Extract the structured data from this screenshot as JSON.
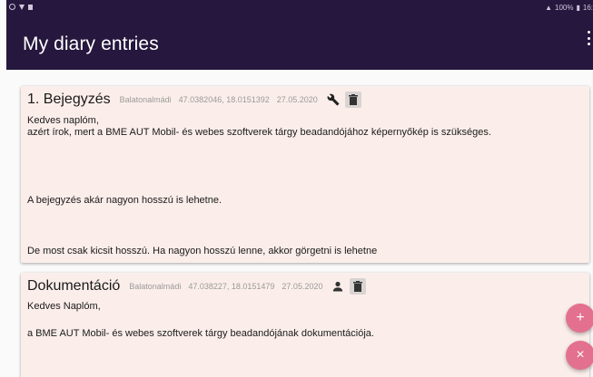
{
  "status_bar": {
    "right_text": "100%",
    "time": "16:"
  },
  "app_bar": {
    "title": "My diary entries"
  },
  "entries": [
    {
      "title": "1. Bejegyzés",
      "location": "Balatonalmádi",
      "coordinates": "47.0382046, 18.0151392",
      "date": "27.05.2020",
      "action_icon": "wrench-icon",
      "lines": [
        "Kedves naplóm,",
        "azért írok, mert a BME AUT Mobil- és webes szoftverek tárgy beadandójához képernyőkép is szükséges.",
        "A bejegyzés akár nagyon hosszú is lehetne.",
        "De most csak kicsit hosszú. Ha nagyon hosszú lenne, akkor görgetni is lehetne"
      ]
    },
    {
      "title": "Dokumentáció",
      "location": "Balatonalmádi",
      "coordinates": "47.038227, 18.0151479",
      "date": "27.05.2020",
      "action_icon": "person-icon",
      "lines": [
        "Kedves Naplóm,",
        "a BME AUT Mobil- és webes szoftverek tárgy beadandójának dokumentációja."
      ]
    }
  ],
  "fabs": {
    "add_label": "+",
    "close_label": "×"
  },
  "colors": {
    "app_bar": "#25173d",
    "card": "#fbeeea",
    "fab": "#e3708f"
  }
}
